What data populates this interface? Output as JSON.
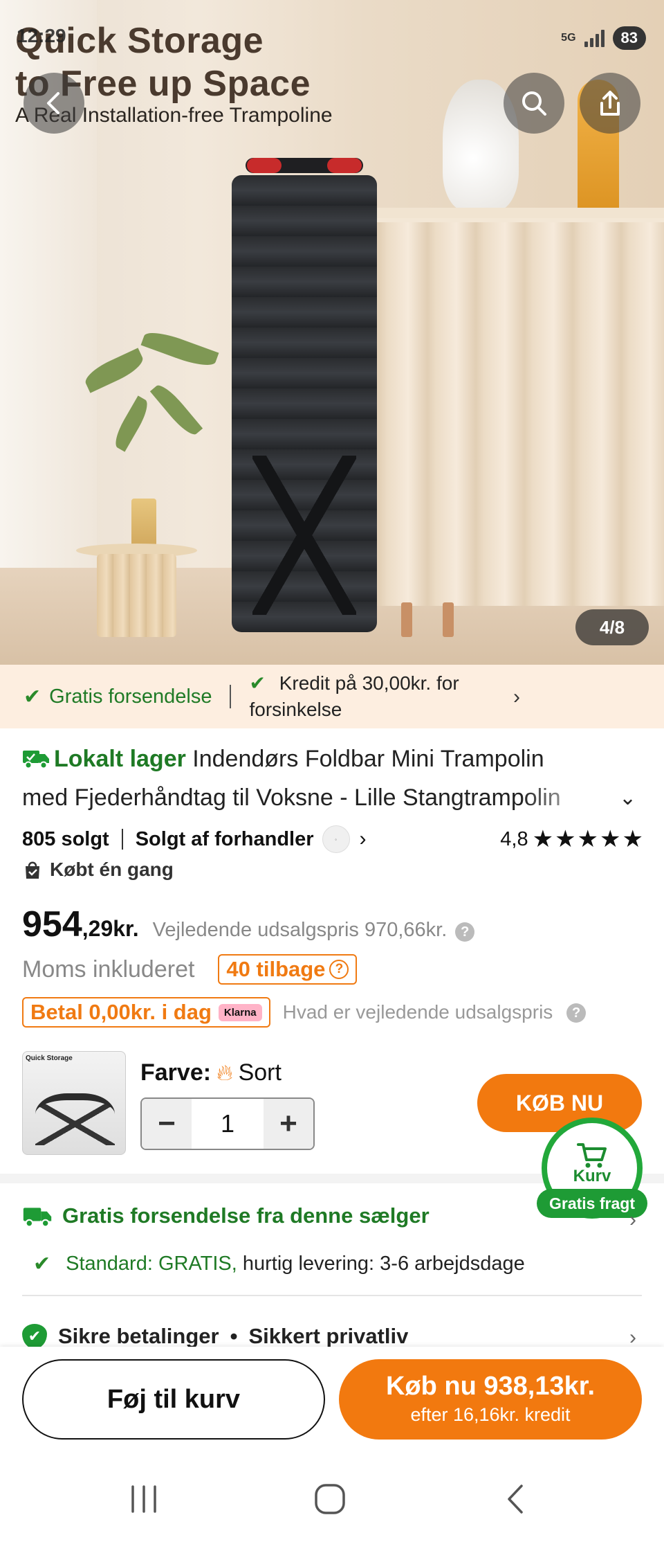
{
  "hero": {
    "headline_line1": "Quick Storage",
    "headline_line2": "to Free up Space",
    "subheadline": "A Real Installation-free Trampoline",
    "image_counter": "4/8"
  },
  "status_bar": {
    "time": "12:29",
    "network": "5G",
    "battery": "83"
  },
  "promo_strip": {
    "shipping": "Gratis forsendelse",
    "credit": "Kredit på 30,00kr. for forsinkelse"
  },
  "product": {
    "local_label": "Lokalt lager",
    "title_line1": "Indendørs Foldbar Mini Trampolin",
    "title_line2": "med Fjederhåndtag til Voksne - Lille Stangtrampolin",
    "sold": "805 solgt",
    "seller": "Solgt af forhandler",
    "rating": "4,8",
    "bought_once": "Købt én gang",
    "price_main": "954",
    "price_decimal": ",29kr.",
    "rrp": "Vejledende udsalgspris 970,66kr.",
    "vat": "Moms inkluderet",
    "back_badge": "40 tilbage",
    "klarna_text": "Betal 0,00kr. i dag",
    "klarna_logo": "Klarna",
    "rrp_question": "Hvad er vejledende udsalgspris"
  },
  "variant": {
    "thumb_label": "Quick Storage",
    "color_label": "Farve:",
    "color_value": "Sort",
    "quantity": "1",
    "buy_now": "KØB NU"
  },
  "cart_float": {
    "label": "Kurv",
    "badge": "Gratis fragt"
  },
  "shipping": {
    "title": "Gratis forsendelse fra denne sælger",
    "standard_label": "Standard: GRATIS,",
    "standard_detail": " hurtig levering: 3-6 arbejdsdage"
  },
  "security": {
    "payments": "Sikre betalinger",
    "privacy": "Sikkert privatliv"
  },
  "actions": {
    "add_to_cart": "Føj til kurv",
    "buy_now_price": "Køb nu 938,13kr.",
    "buy_now_credit": "efter 16,16kr. kredit"
  },
  "colors": {
    "accent_orange": "#f2790f",
    "green": "#1f7a25",
    "promo_bg": "#fdeee0"
  }
}
